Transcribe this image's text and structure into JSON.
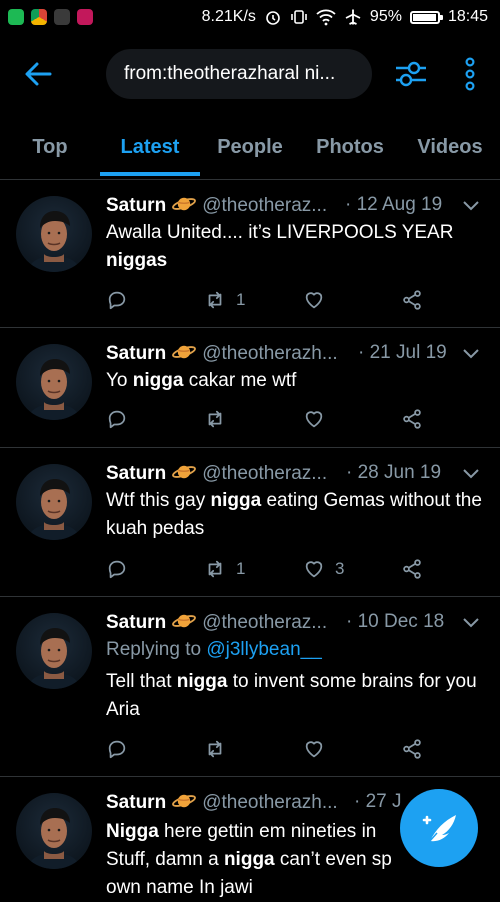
{
  "status_bar": {
    "speed": "8.21K/s",
    "battery": "95%",
    "battery_level": 0.95,
    "time": "18:45",
    "app_icons": [
      "spotify-icon",
      "chrome-icon",
      "podcast-icon",
      "mail-icon"
    ]
  },
  "header": {
    "search_query": "from:theotherazharal ni..."
  },
  "tabs": [
    {
      "label": "Top",
      "active": false
    },
    {
      "label": "Latest",
      "active": true
    },
    {
      "label": "People",
      "active": false
    },
    {
      "label": "Photos",
      "active": false
    },
    {
      "label": "Videos",
      "active": false
    }
  ],
  "tweets": [
    {
      "name": "Saturn",
      "handle": "@theotheraz...",
      "date": "· 12 Aug 19",
      "text_html": "Awalla United.... it’s LIVERPOOLS YEAR <b>niggas</b>",
      "retweets": "1",
      "likes": ""
    },
    {
      "name": "Saturn",
      "handle": "@theotherazh...",
      "date": "· 21 Jul 19",
      "text_html": "Yo <b>nigga</b> cakar me wtf",
      "retweets": "",
      "likes": ""
    },
    {
      "name": "Saturn",
      "handle": "@theotheraz...",
      "date": "· 28 Jun 19",
      "text_html": "Wtf this gay <b>nigga</b> eating Gemas without the kuah pedas",
      "retweets": "1",
      "likes": "3"
    },
    {
      "name": "Saturn",
      "handle": "@theotheraz...",
      "date": "· 10 Dec 18",
      "replying_to_prefix": "Replying to",
      "replying_to_user": "@j3llybean__",
      "text_html": "Tell that <b>nigga</b> to invent some brains for you Aria",
      "retweets": "",
      "likes": ""
    },
    {
      "name": "Saturn",
      "handle": "@theotherazh...",
      "date": "· 27 J",
      "text_html": "<b>Nigga</b> here gettin em nineties in<br>Stuff, damn a <b>nigga</b> can’t even sp<br>own name In jawi",
      "retweets": "",
      "likes": ""
    }
  ],
  "colors": {
    "background": "#000000",
    "accent": "#1da1f2",
    "secondary_text": "#8899a6",
    "divider": "#2f3336"
  }
}
